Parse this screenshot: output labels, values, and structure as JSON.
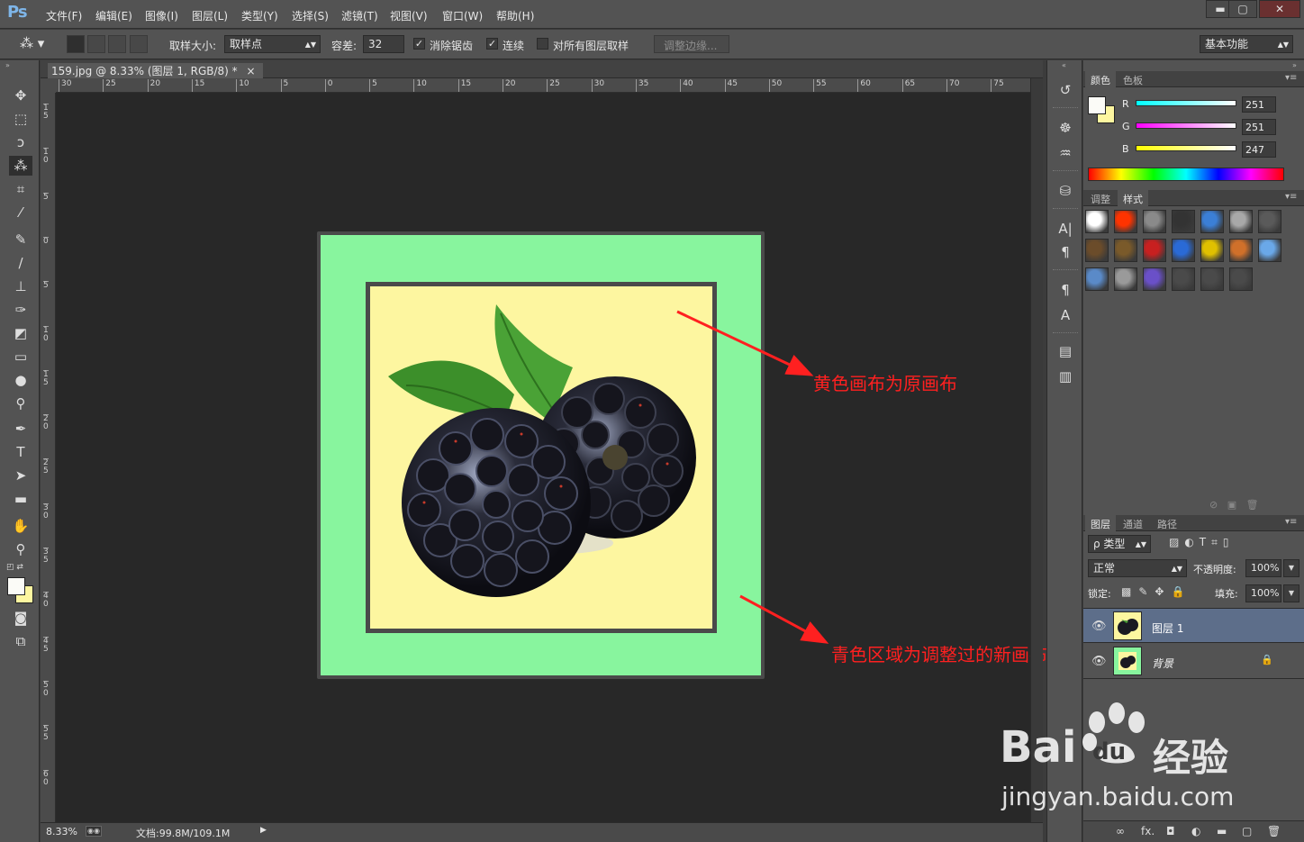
{
  "app": {
    "logo": "Ps",
    "menu": [
      "文件(F)",
      "编辑(E)",
      "图像(I)",
      "图层(L)",
      "类型(Y)",
      "选择(S)",
      "滤镜(T)",
      "视图(V)",
      "窗口(W)",
      "帮助(H)"
    ],
    "window_controls": [
      "▬",
      "▢",
      "✕"
    ]
  },
  "options_bar": {
    "sample_size_label": "取样大小:",
    "sample_size_value": "取样点",
    "tolerance_label": "容差:",
    "tolerance_value": "32",
    "antialias_label": "消除锯齿",
    "antialias_checked": true,
    "contiguous_label": "连续",
    "contiguous_checked": true,
    "all_layers_label": "对所有图层取样",
    "all_layers_checked": false,
    "refine_edge_label": "调整边缘...",
    "workspace_value": "基本功能"
  },
  "document": {
    "tab_title": "159.jpg @ 8.33% (图层 1, RGB/8) *",
    "tab_close": "×",
    "zoom": "8.33%",
    "doc_info": "文档:99.8M/109.1M",
    "ruler_h_ticks": [
      "30",
      "25",
      "20",
      "15",
      "10",
      "5",
      "0",
      "5",
      "10",
      "15",
      "20",
      "25",
      "30",
      "35",
      "40",
      "45",
      "50",
      "55",
      "60",
      "65",
      "70",
      "75"
    ],
    "ruler_v_ticks": [
      "1\n5",
      "1\n0",
      "5",
      "0",
      "5",
      "1\n0",
      "1\n5",
      "2\n0",
      "2\n5",
      "3\n0",
      "3\n5",
      "4\n0",
      "4\n5",
      "5\n0",
      "5\n5",
      "6\n0"
    ]
  },
  "annotations": {
    "yellow_note": "黄色画布为原画布",
    "cyan_note": "青色区域为调整过的新画布"
  },
  "color_panel": {
    "tabs": [
      "颜色",
      "色板"
    ],
    "channels": [
      {
        "label": "R",
        "value": "251",
        "color": "#00ffff"
      },
      {
        "label": "G",
        "value": "251",
        "color": "#ff00ff"
      },
      {
        "label": "B",
        "value": "247",
        "color": "#ffff00"
      }
    ],
    "foreground": "#fbfbf7",
    "background": "#fdf6a0"
  },
  "styles_panel": {
    "tabs": [
      "调整",
      "样式"
    ],
    "swatches": [
      "#ffffff",
      "#ff3300",
      "#8a8a8a",
      "#333333",
      "#3b7fd6",
      "#a8a8a8",
      "#5a5a5a",
      "#6b4c2a",
      "#7a5a2a",
      "#c82020",
      "#2a6ad6",
      "#e0c000",
      "#d0702a",
      "#6aa8e8",
      "#5a8ac8",
      "#9a9a9a",
      "#6a50c8",
      "#4a4a4a",
      "#4a4a4a",
      "#4a4a4a"
    ]
  },
  "layers_panel": {
    "tabs": [
      "图层",
      "通道",
      "路径"
    ],
    "filter_label": "ρ 类型",
    "blend_mode": "正常",
    "opacity_label": "不透明度:",
    "opacity_value": "100%",
    "lock_label": "锁定:",
    "fill_label": "填充:",
    "fill_value": "100%",
    "layers": [
      {
        "name": "图层 1",
        "selected": true
      },
      {
        "name": "背景",
        "selected": false,
        "locked": true
      }
    ],
    "footer_icons": [
      "∞",
      "fx.",
      "◘",
      "◐",
      "▬",
      "▢",
      "🗑"
    ]
  },
  "watermark": {
    "brand": "Bai",
    "brand_du": "du",
    "brand_cn": "经验",
    "url": "jingyan.baidu.com"
  }
}
